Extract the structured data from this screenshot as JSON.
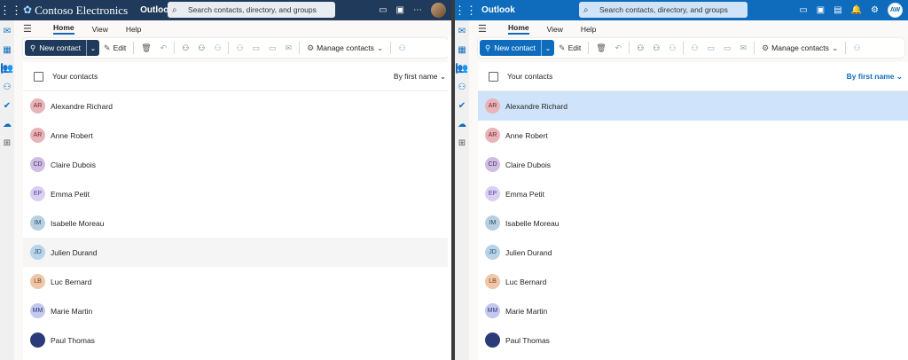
{
  "left": {
    "brand": "Contoso Electronics",
    "app": "Outlook",
    "search_placeholder": "Search contacts, directory, and groups",
    "menu_tabs": [
      "Home",
      "View",
      "Help"
    ],
    "new_contact": "New contact",
    "edit": "Edit",
    "manage_contacts": "Manage contacts",
    "header": "Your contacts",
    "sort": "By first name",
    "contacts": [
      {
        "initials": "AR",
        "name": "Alexandre Richard",
        "bg": "#e8b4b8",
        "fg": "#6b2a30"
      },
      {
        "initials": "AR",
        "name": "Anne Robert",
        "bg": "#e8b4b8",
        "fg": "#6b2a30"
      },
      {
        "initials": "CD",
        "name": "Claire Dubois",
        "bg": "#cfbde2",
        "fg": "#4b2e74"
      },
      {
        "initials": "EP",
        "name": "Emma Petit",
        "bg": "#d9cff0",
        "fg": "#5b3fa0"
      },
      {
        "initials": "IM",
        "name": "Isabelle Moreau",
        "bg": "#b8cfe0",
        "fg": "#1e4a6b"
      },
      {
        "initials": "JD",
        "name": "Julien Durand",
        "bg": "#b9d3e8",
        "fg": "#1b4f7a"
      },
      {
        "initials": "LB",
        "name": "Luc Bernard",
        "bg": "#efc6a8",
        "fg": "#7a3e12"
      },
      {
        "initials": "MM",
        "name": "Marie Martin",
        "bg": "#c4c8ee",
        "fg": "#2f3584"
      },
      {
        "initials": "",
        "name": "Paul Thomas",
        "bg": "#2b3a78",
        "fg": "#ffffff"
      }
    ]
  },
  "right": {
    "app": "Outlook",
    "search_placeholder": "Search contacts, directory, and groups",
    "menu_tabs": [
      "Home",
      "View",
      "Help"
    ],
    "new_contact": "New contact",
    "edit": "Edit",
    "manage_contacts": "Manage contacts",
    "header": "Your contacts",
    "sort": "By first name",
    "user_initials": "AW",
    "contacts": [
      {
        "initials": "AR",
        "name": "Alexandre Richard",
        "bg": "#e8b4b8",
        "fg": "#6b2a30"
      },
      {
        "initials": "AR",
        "name": "Anne Robert",
        "bg": "#e8b4b8",
        "fg": "#6b2a30"
      },
      {
        "initials": "CD",
        "name": "Claire Dubois",
        "bg": "#cfbde2",
        "fg": "#4b2e74"
      },
      {
        "initials": "EP",
        "name": "Emma Petit",
        "bg": "#d9cff0",
        "fg": "#5b3fa0"
      },
      {
        "initials": "IM",
        "name": "Isabelle Moreau",
        "bg": "#b8cfe0",
        "fg": "#1e4a6b"
      },
      {
        "initials": "JD",
        "name": "Julien Durand",
        "bg": "#b9d3e8",
        "fg": "#1b4f7a"
      },
      {
        "initials": "LB",
        "name": "Luc Bernard",
        "bg": "#efc6a8",
        "fg": "#7a3e12"
      },
      {
        "initials": "MM",
        "name": "Marie Martin",
        "bg": "#c4c8ee",
        "fg": "#2f3584"
      },
      {
        "initials": "",
        "name": "Paul Thomas",
        "bg": "#2b3a78",
        "fg": "#ffffff"
      }
    ]
  },
  "colors": {
    "brand_dark": "#1f3a5a",
    "accent": "#0f6cbd",
    "selected_row": "#cfe4fa"
  }
}
